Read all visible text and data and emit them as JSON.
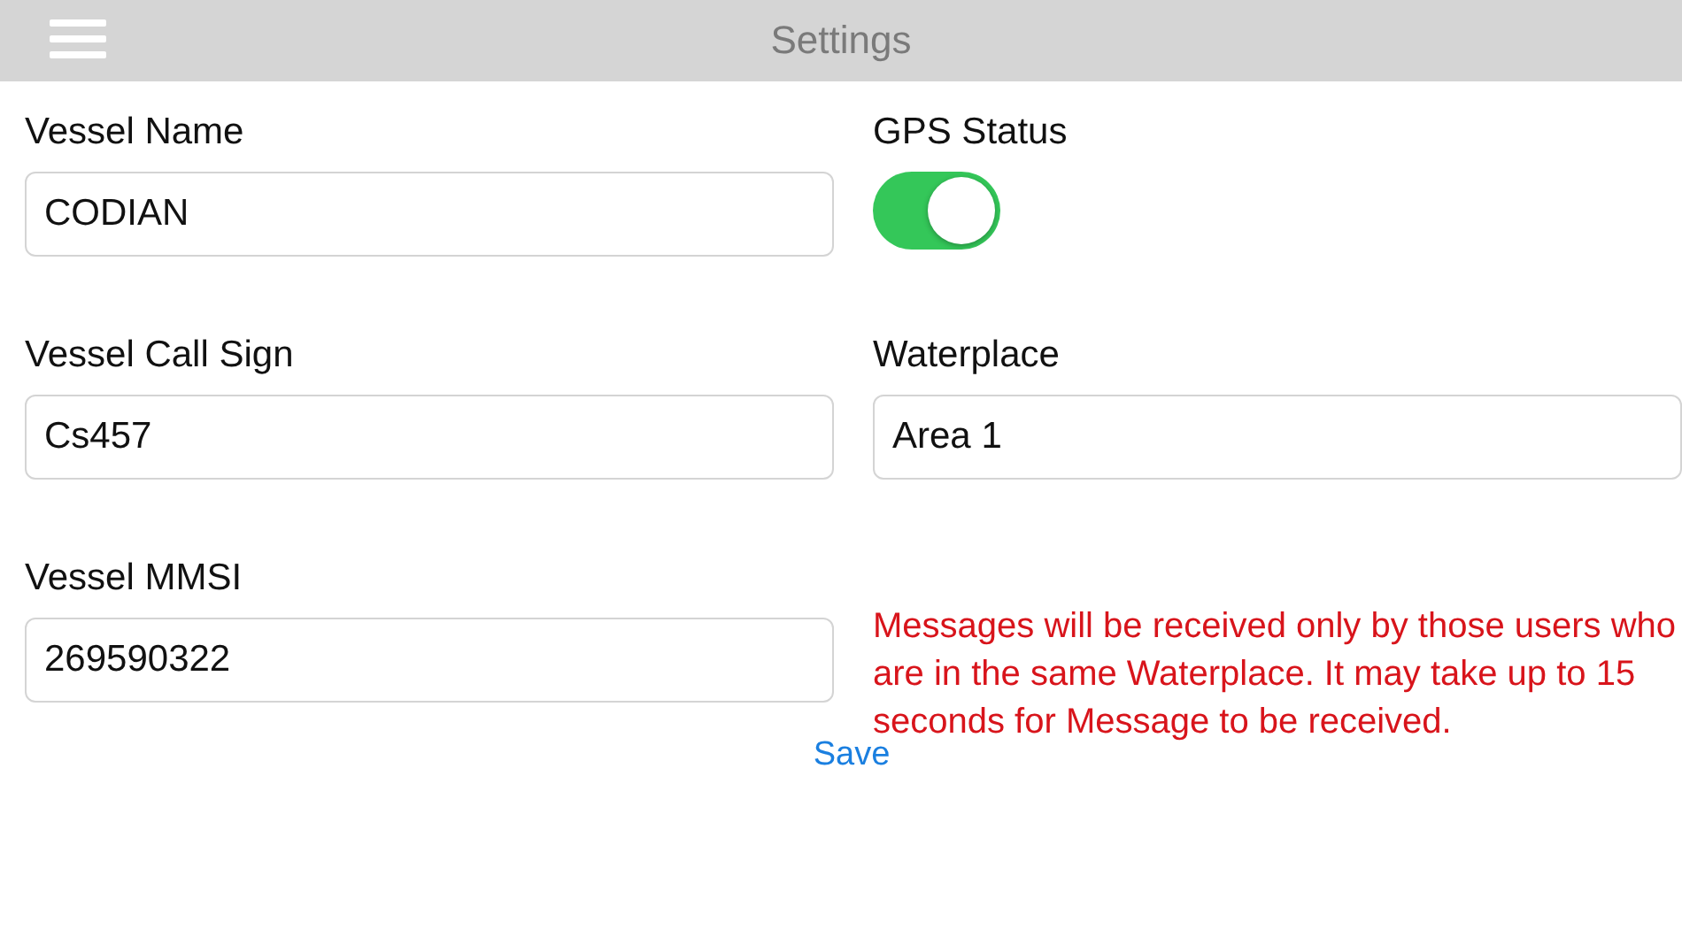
{
  "header": {
    "title": "Settings"
  },
  "fields": [
    {
      "kind": "input",
      "label": "Vessel Name",
      "value": "CODIAN"
    },
    {
      "kind": "switch",
      "label": "GPS Status",
      "on": true
    },
    {
      "kind": "input",
      "label": "Vessel Call Sign",
      "value": "Cs457"
    },
    {
      "kind": "input",
      "label": "Waterplace",
      "value": "Area 1"
    },
    {
      "kind": "input",
      "label": "Vessel MMSI",
      "value": "269590322"
    },
    {
      "kind": "note",
      "text": "Messages will be received only by those users who are in the same Waterplace. It may take up to 15 seconds for Message to be received."
    }
  ],
  "save_button": "Save"
}
